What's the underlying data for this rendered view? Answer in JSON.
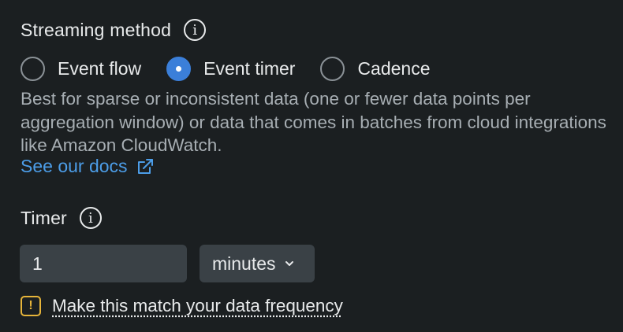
{
  "streaming": {
    "label": "Streaming method",
    "info_glyph": "i",
    "options": [
      {
        "label": "Event flow",
        "checked": false
      },
      {
        "label": "Event timer",
        "checked": true
      },
      {
        "label": "Cadence",
        "checked": false
      }
    ],
    "description": "Best for sparse or inconsistent data (one or fewer data points per aggregation window) or data that comes in batches from cloud integrations like Amazon CloudWatch.",
    "docs_link": "See our docs"
  },
  "timer": {
    "label": "Timer",
    "info_glyph": "i",
    "value": "1",
    "unit": "minutes"
  },
  "warning": {
    "glyph": "!",
    "text": "Make this match your data frequency"
  },
  "colors": {
    "background": "#1b1f21",
    "accent": "#3b7fd9",
    "link": "#4c9de8",
    "warning": "#e6b43a"
  }
}
